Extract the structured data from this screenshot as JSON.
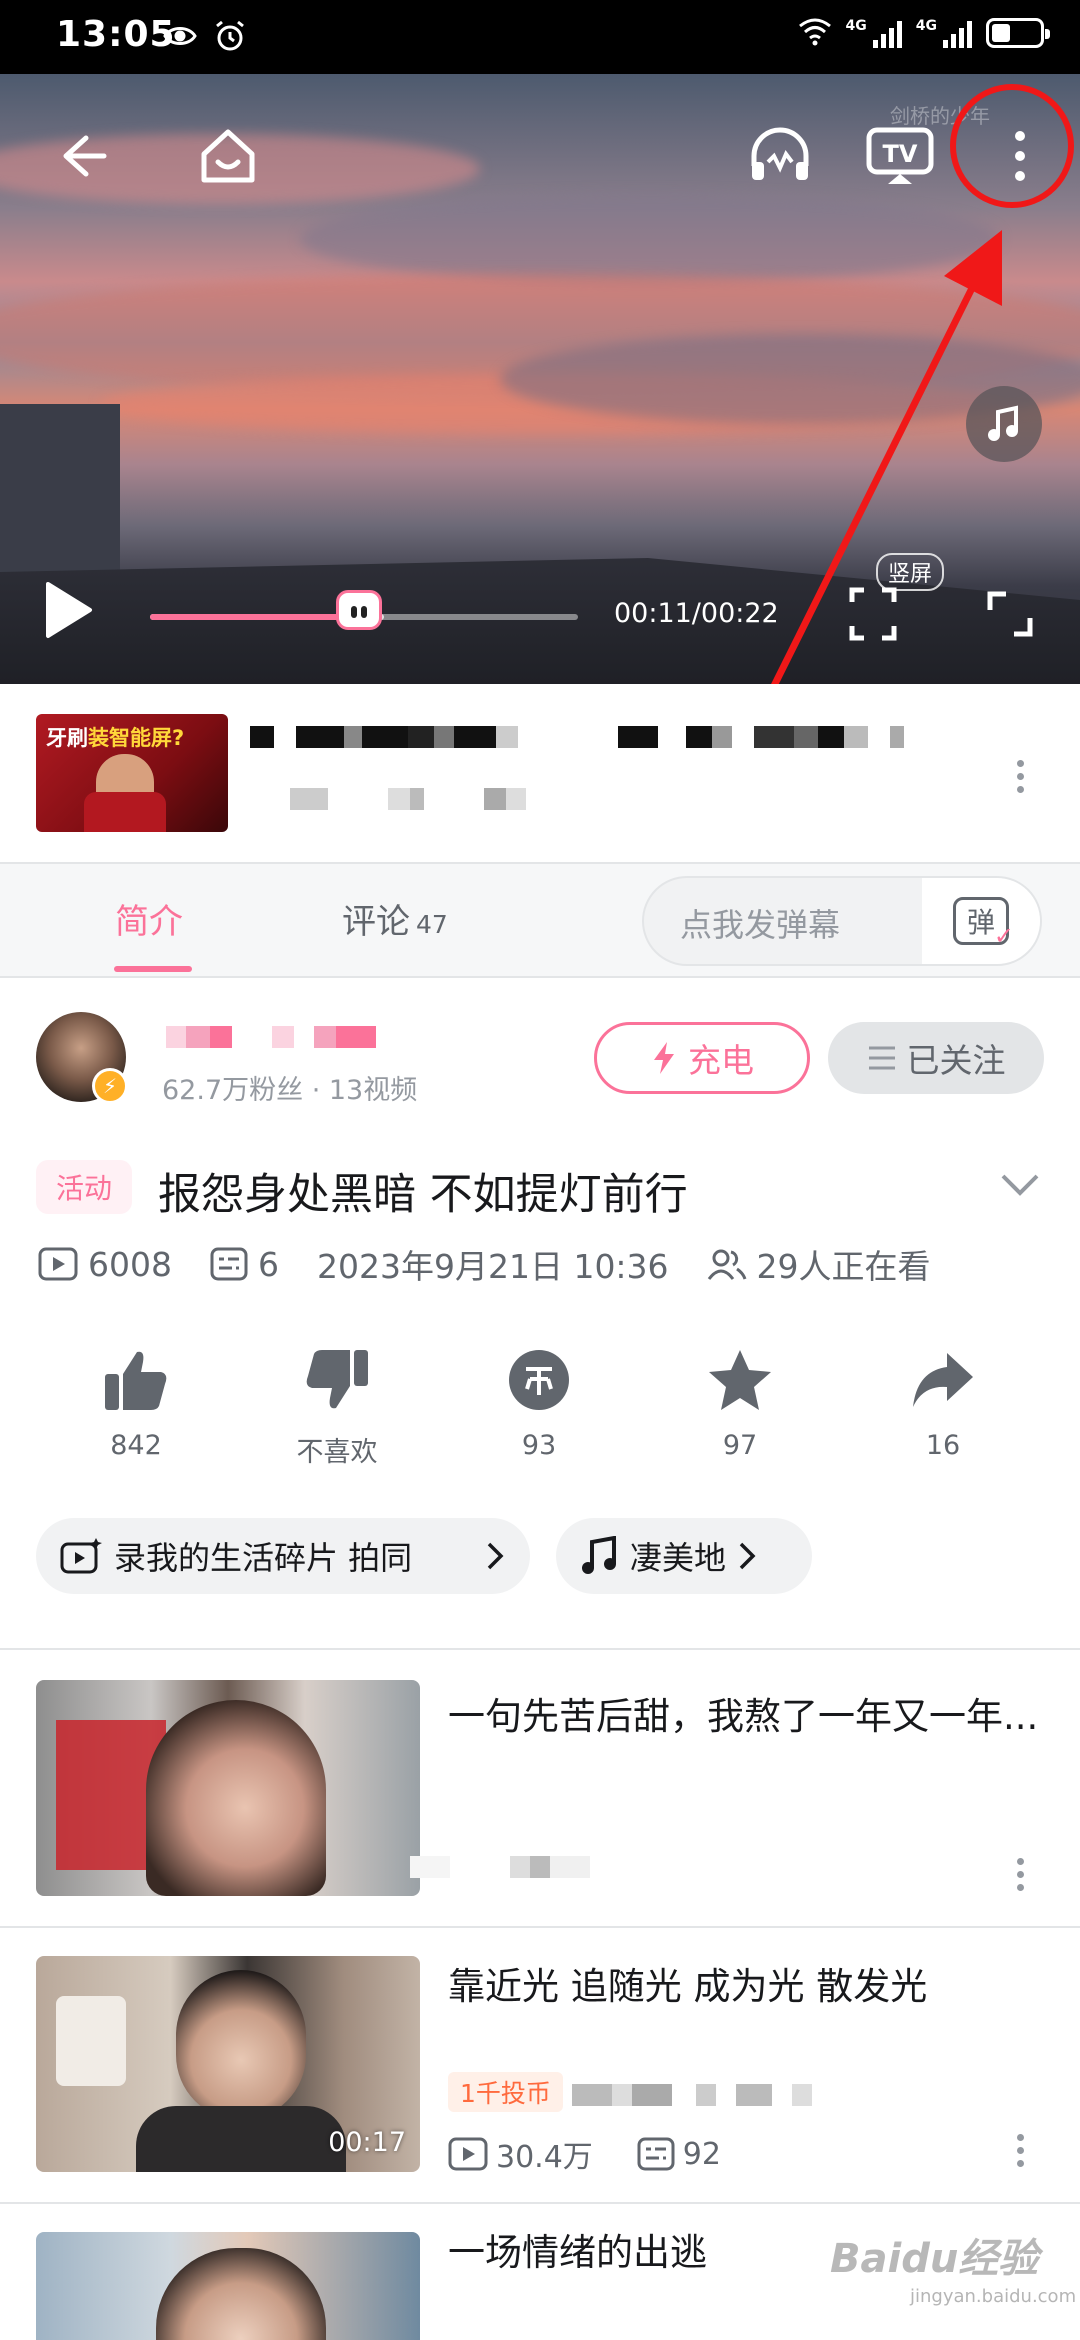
{
  "status_bar": {
    "time": "13:05",
    "net_label_1": "4G",
    "net_label_2": "4G"
  },
  "player": {
    "current_time": "00:11",
    "total_time": "00:22",
    "time_display": "00:11/00:22",
    "progress": 0.5,
    "vertical_screen_label": "竖屏",
    "watermark": "剑桥的少年"
  },
  "ad": {
    "thumb_text_white": "牙刷",
    "thumb_text_yellow": "装智能屏?"
  },
  "tabs": {
    "intro": "简介",
    "comments": "评论",
    "comments_count": "47",
    "danmaku_placeholder": "点我发弹幕",
    "danmaku_button": "弹"
  },
  "uploader": {
    "stats": "62.7万粉丝  ·  13视频",
    "charge_label": "充电",
    "follow_label": "已关注"
  },
  "video": {
    "activity_tag": "活动",
    "title": "报怨身处黑暗 不如提灯前行",
    "views": "6008",
    "danmaku_count": "6",
    "publish_time": "2023年9月21日 10:36",
    "watching": "29人正在看"
  },
  "actions": [
    {
      "name": "like",
      "label": "842"
    },
    {
      "name": "dislike",
      "label": "不喜欢"
    },
    {
      "name": "coin",
      "label": "93"
    },
    {
      "name": "favorite",
      "label": "97"
    },
    {
      "name": "share",
      "label": "16"
    }
  ],
  "chips": {
    "topic": "录我的生活碎片   拍同",
    "music": "凄美地"
  },
  "recommendations": [
    {
      "title": "一句先苦后甜，我熬了一年又一年...",
      "duration": ""
    },
    {
      "title": "靠近光 追随光 成为光 散发光",
      "duration": "00:17",
      "tag": "1千投币",
      "views": "30.4万",
      "danmaku": "92"
    },
    {
      "title": "一场情绪的出逃",
      "duration": ""
    }
  ],
  "watermark_brand": "Baidu经验",
  "watermark_sub": "jingyan.baidu.com",
  "colors": {
    "accent_pink": "#fb7299",
    "annotation_red": "#f01818",
    "text_secondary": "#61666d"
  }
}
